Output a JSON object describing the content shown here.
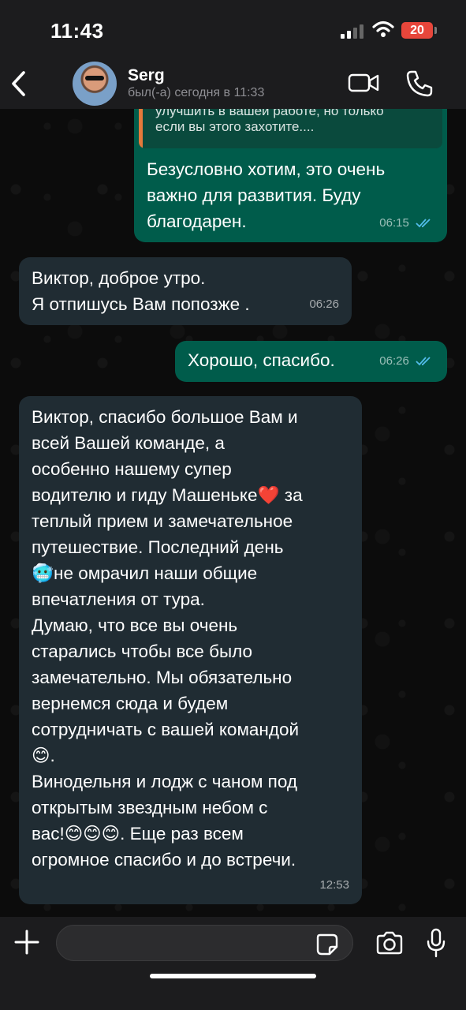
{
  "status_bar": {
    "time": "11:43",
    "battery": "20"
  },
  "header": {
    "contact_name": "Serg",
    "contact_status": "был(-а) сегодня в 11:33"
  },
  "messages": [
    {
      "direction": "outgoing",
      "quoted": [
        "улучшить в вашей работе, но только",
        "если вы этого захотите...."
      ],
      "text": "Безусловно хотим, это очень\nважно для развития. Буду\nблагодарен.",
      "time": "06:15",
      "status": "read"
    },
    {
      "direction": "incoming",
      "text": "Виктор, доброе утро.\nЯ отпишусь Вам попозже .",
      "time": "06:26"
    },
    {
      "direction": "outgoing",
      "text": "Хорошо, спасибо.",
      "time": "06:26",
      "status": "read"
    },
    {
      "direction": "incoming",
      "lines": [
        "Виктор, спасибо большое Вам и",
        "всей Вашей команде, а",
        "особенно нашему супер",
        "водителю и гиду Машеньке❤️ за",
        "теплый прием и замечательное",
        "путешествие. Последний день",
        "🥶не омрачил наши общие",
        "впечатления от тура.",
        "Думаю, что все вы очень",
        "старались чтобы все было",
        "замечательно. Мы обязательно",
        "вернемся сюда и будем",
        "сотрудничать с вашей командой",
        "😊.",
        "Винодельня и лодж с чаном под",
        "открытым звездным небом с",
        "вас!😊😊😊. Еще раз всем",
        "огромное спасибо и до встречи."
      ],
      "time": "12:53"
    }
  ],
  "input": {
    "placeholder": ""
  },
  "colors": {
    "outgoing_bubble": "#005c4b",
    "incoming_bubble": "#202c33",
    "read_ticks": "#53bdeb",
    "quote_bar": "#e5793b"
  }
}
